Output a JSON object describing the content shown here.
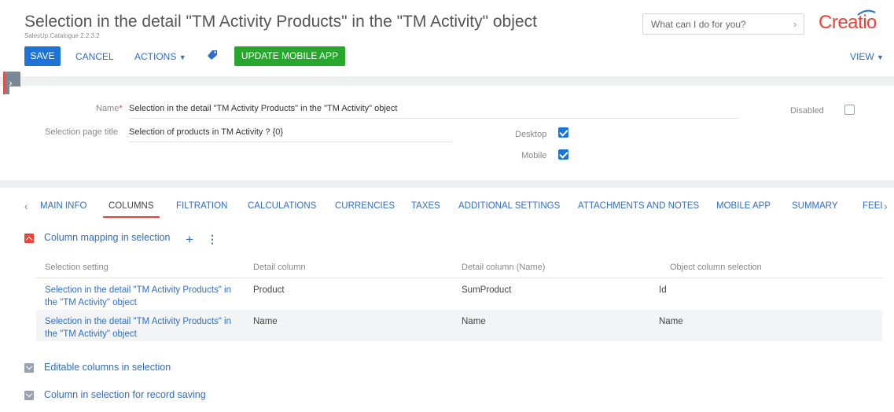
{
  "header": {
    "title": "Selection in the detail \"TM Activity Products\" in the \"TM Activity\" object",
    "subtitle": "SalesUp.Catalogue 2.2.3.2",
    "search_placeholder": "What can I do for you?",
    "logo": "Creatio"
  },
  "toolbar": {
    "save_label": "SAVE",
    "cancel_label": "CANCEL",
    "actions_label": "ACTIONS",
    "update_mobile_label": "UPDATE MOBILE APP",
    "view_label": "VIEW"
  },
  "form": {
    "name_label": "Name",
    "name_value": "Selection in the detail \"TM Activity Products\" in the \"TM Activity\" object",
    "page_title_label": "Selection page title",
    "page_title_value": "Selection of products in TM Activity ? {0}",
    "disabled_label": "Disabled",
    "disabled_checked": false,
    "desktop_label": "Desktop",
    "desktop_checked": true,
    "mobile_label": "Mobile",
    "mobile_checked": true
  },
  "tabs": [
    {
      "label": "MAIN INFO",
      "active": false
    },
    {
      "label": "COLUMNS",
      "active": true
    },
    {
      "label": "FILTRATION",
      "active": false
    },
    {
      "label": "CALCULATIONS",
      "active": false
    },
    {
      "label": "CURRENCIES",
      "active": false
    },
    {
      "label": "TAXES",
      "active": false
    },
    {
      "label": "ADDITIONAL SETTINGS",
      "active": false
    },
    {
      "label": "ATTACHMENTS AND NOTES",
      "active": false
    },
    {
      "label": "MOBILE APP",
      "active": false
    },
    {
      "label": "SUMMARY",
      "active": false
    },
    {
      "label": "FEEI",
      "active": false
    }
  ],
  "sections": {
    "mapping_title": "Column mapping in selection",
    "editable_title": "Editable columns in selection",
    "saving_title": "Column in selection for record saving"
  },
  "grid": {
    "columns": [
      "Selection setting",
      "Detail column",
      "Detail column (Name)",
      "Object column selection"
    ],
    "rows": [
      {
        "setting": "Selection in the detail \"TM Activity Products\" in the \"TM Activity\" object",
        "detail_column": "Product",
        "detail_column_name": "SumProduct",
        "object_column": "Id"
      },
      {
        "setting": "Selection in the detail \"TM Activity Products\" in the \"TM Activity\" object",
        "detail_column": "Name",
        "detail_column_name": "Name",
        "object_column": "Name"
      }
    ]
  },
  "colors": {
    "accent": "#1e73d8",
    "brand": "#ef4136",
    "success": "#27a82d",
    "link": "#2f6ec6"
  }
}
